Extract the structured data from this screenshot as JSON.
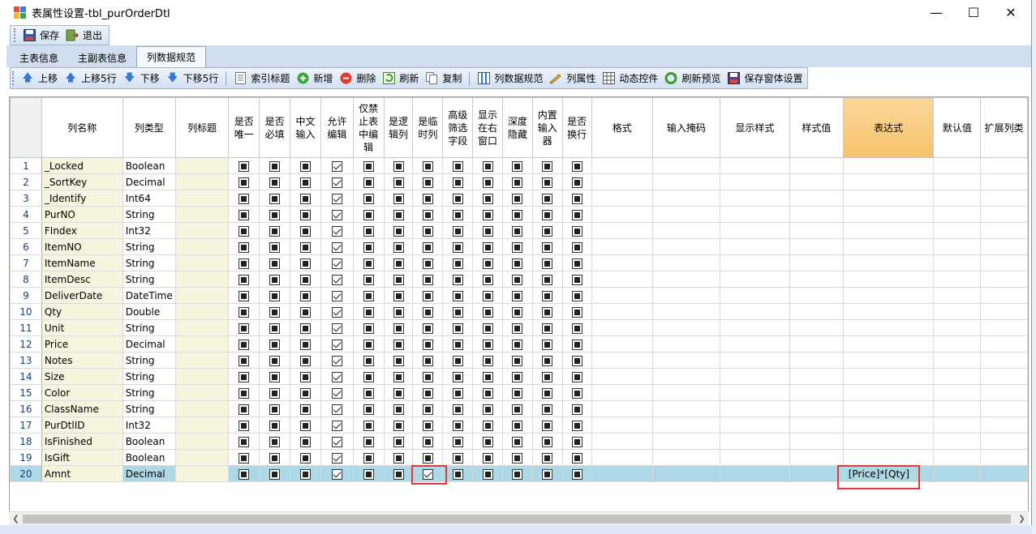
{
  "window": {
    "title": "表属性设置-tbl_purOrderDtl",
    "controls": {
      "minimize": "—",
      "maximize": "☐",
      "close": "✕"
    }
  },
  "toolbar1": {
    "save": "保存",
    "exit": "退出"
  },
  "tabs": [
    {
      "label": "主表信息",
      "active": false
    },
    {
      "label": "主副表信息",
      "active": false
    },
    {
      "label": "列数据规范",
      "active": true
    }
  ],
  "toolbar2": {
    "move_up": "上移",
    "move_up5": "上移5行",
    "move_down": "下移",
    "move_down5": "下移5行",
    "index_title": "索引标题",
    "add": "新增",
    "delete": "删除",
    "refresh": "刷新",
    "copy": "复制",
    "column_spec": "列数据规范",
    "column_props": "列属性",
    "dynamic_ctrl": "动态控件",
    "refresh_preview": "刷新预览",
    "save_form": "保存窗体设置"
  },
  "grid": {
    "headers": [
      "列名称",
      "列类型",
      "列标题",
      "是否唯一",
      "是否必填",
      "中文输入",
      "允许编辑",
      "仅禁止表中编辑",
      "是逻辑列",
      "是临时列",
      "高级筛选字段",
      "显示在右窗口",
      "深度隐藏",
      "内置输入器",
      "是否换行",
      "格式",
      "输入掩码",
      "显示样式",
      "样式值",
      "表达式",
      "默认值",
      "扩展列类"
    ],
    "rows": [
      {
        "no": "1",
        "name": "_Locked",
        "type": "Boolean",
        "title": ""
      },
      {
        "no": "2",
        "name": "_SortKey",
        "type": "Decimal",
        "title": ""
      },
      {
        "no": "3",
        "name": "_Identify",
        "type": "Int64",
        "title": ""
      },
      {
        "no": "4",
        "name": "PurNO",
        "type": "String",
        "title": ""
      },
      {
        "no": "5",
        "name": "FIndex",
        "type": "Int32",
        "title": ""
      },
      {
        "no": "6",
        "name": "ItemNO",
        "type": "String",
        "title": ""
      },
      {
        "no": "7",
        "name": "ItemName",
        "type": "String",
        "title": ""
      },
      {
        "no": "8",
        "name": "ItemDesc",
        "type": "String",
        "title": ""
      },
      {
        "no": "9",
        "name": "DeliverDate",
        "type": "DateTime",
        "title": ""
      },
      {
        "no": "10",
        "name": "Qty",
        "type": "Double",
        "title": ""
      },
      {
        "no": "11",
        "name": "Unit",
        "type": "String",
        "title": ""
      },
      {
        "no": "12",
        "name": "Price",
        "type": "Decimal",
        "title": ""
      },
      {
        "no": "13",
        "name": "Notes",
        "type": "String",
        "title": ""
      },
      {
        "no": "14",
        "name": "Size",
        "type": "String",
        "title": ""
      },
      {
        "no": "15",
        "name": "Color",
        "type": "String",
        "title": ""
      },
      {
        "no": "16",
        "name": "ClassName",
        "type": "String",
        "title": ""
      },
      {
        "no": "17",
        "name": "PurDtlID",
        "type": "Int32",
        "title": ""
      },
      {
        "no": "18",
        "name": "IsFinished",
        "type": "Boolean",
        "title": ""
      },
      {
        "no": "19",
        "name": "IsGift",
        "type": "Boolean",
        "title": ""
      },
      {
        "no": "20",
        "name": "Amnt",
        "type": "Decimal",
        "title": "",
        "is_temp": true,
        "expression": "[Price]*[Qty]",
        "selected": true
      }
    ]
  },
  "colors": {
    "selected_row": "#add8e6",
    "name_column": "#f5f5dd",
    "highlight": "#e53935",
    "selected_header": "#f6c26a"
  },
  "icons": {
    "save": "save-icon",
    "exit": "exit-icon",
    "up": "arrow-up-icon",
    "down": "arrow-down-icon",
    "index": "document-icon",
    "add": "plus-circle-icon",
    "delete": "minus-circle-icon",
    "refresh": "refresh-icon",
    "copy": "copy-icon",
    "spec": "columns-icon",
    "props": "pencil-icon",
    "dynamic": "grid-icon",
    "preview": "recycle-icon",
    "save_form": "save-icon"
  }
}
